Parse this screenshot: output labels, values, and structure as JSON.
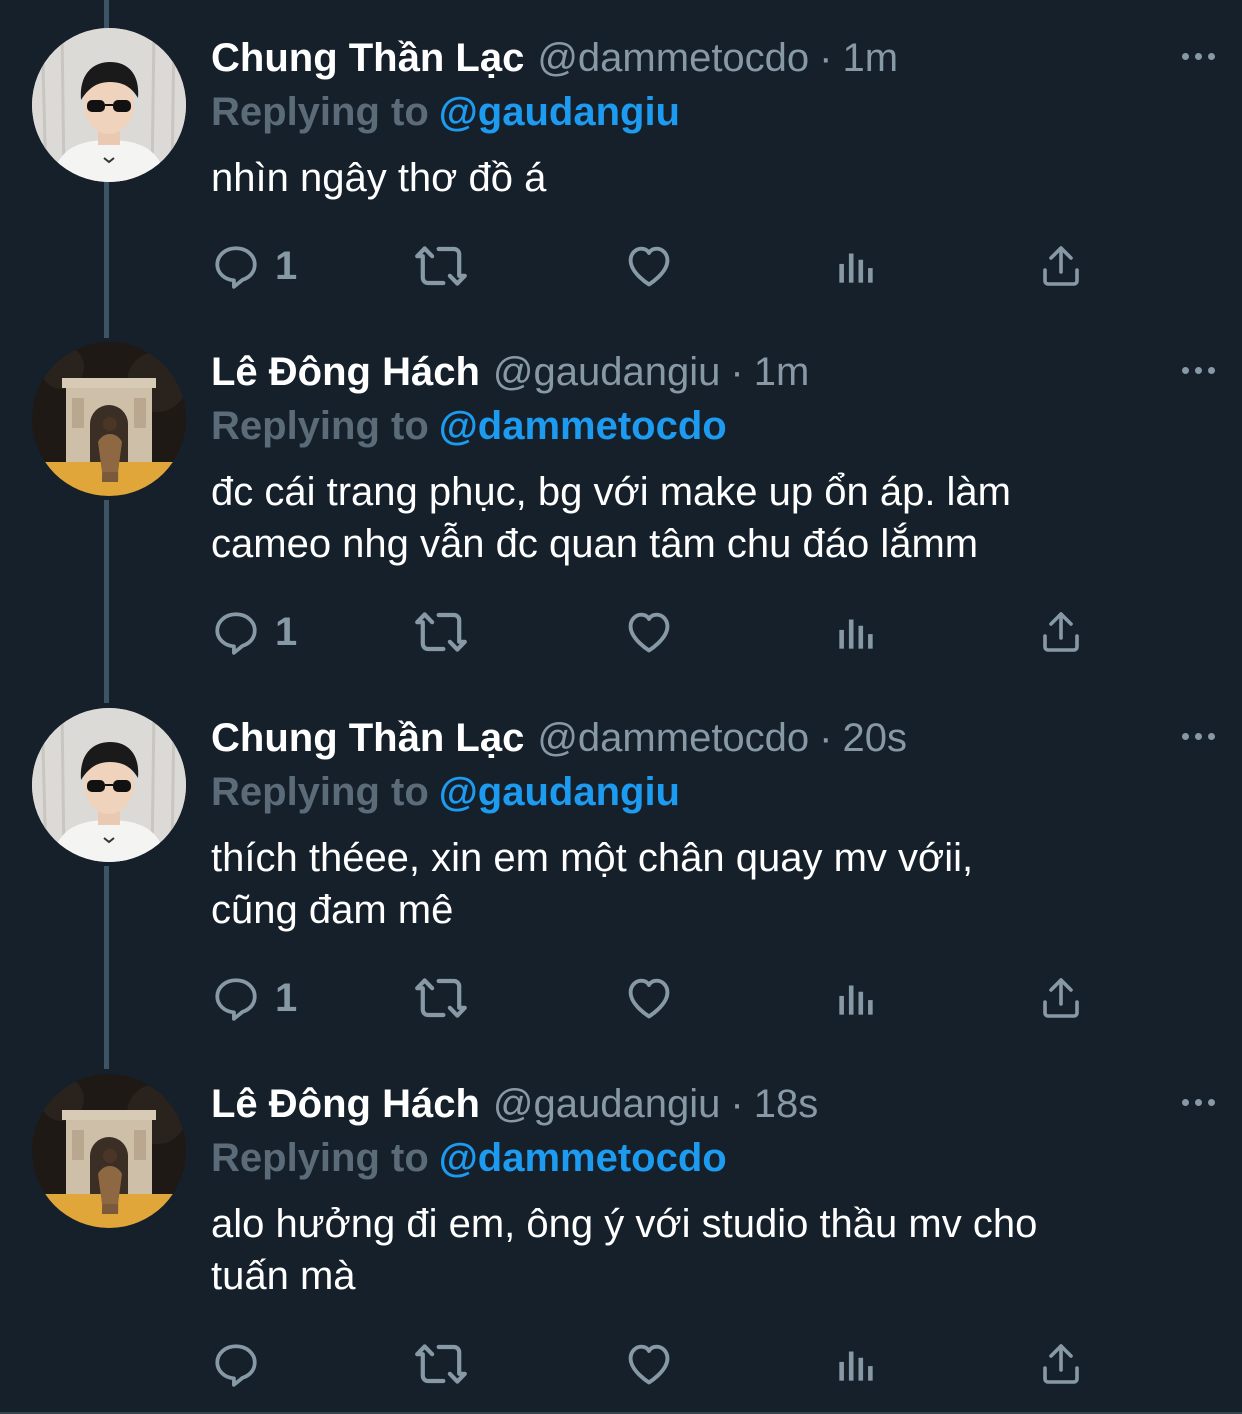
{
  "theme": {
    "background": "#15202b",
    "secondary_text": "#8899a6",
    "link": "#1d9bf0",
    "thread_line": "#3d5466"
  },
  "tweets": [
    {
      "name": "Chung Thần Lạc",
      "handle": "@dammetocdo",
      "separator": "·",
      "time": "1m",
      "reply_prefix": "Replying to",
      "reply_to": "@gaudangiu",
      "text_lines": [
        "nhìn ngây thơ đồ á"
      ],
      "reply_count": "1",
      "avatar_icon": "avatar-boy-sunglasses"
    },
    {
      "name": "Lê Đông Hách",
      "handle": "@gaudangiu",
      "separator": "·",
      "time": "1m",
      "reply_prefix": "Replying to",
      "reply_to": "@dammetocdo",
      "text_lines": [
        "đc cái trang phục, bg với make up ổn áp. làm",
        "cameo nhg vẫn đc quan tâm chu đáo lắmm"
      ],
      "reply_count": "1",
      "avatar_icon": "avatar-arc-de-triomphe"
    },
    {
      "name": "Chung Thần Lạc",
      "handle": "@dammetocdo",
      "separator": "·",
      "time": "20s",
      "reply_prefix": "Replying to",
      "reply_to": "@gaudangiu",
      "text_lines": [
        "thích théee, xin em một chân quay mv vớii,",
        "cũng đam mê"
      ],
      "reply_count": "1",
      "avatar_icon": "avatar-boy-sunglasses"
    },
    {
      "name": "Lê Đông Hách",
      "handle": "@gaudangiu",
      "separator": "·",
      "time": "18s",
      "reply_prefix": "Replying to",
      "reply_to": "@dammetocdo",
      "text_lines": [
        "alo hưởng đi em, ông ý với studio thầu mv cho",
        "tuấn mà"
      ],
      "reply_count": "",
      "avatar_icon": "avatar-arc-de-triomphe"
    }
  ],
  "action_icons": [
    "reply-icon",
    "retweet-icon",
    "like-icon",
    "analytics-icon",
    "share-icon"
  ]
}
